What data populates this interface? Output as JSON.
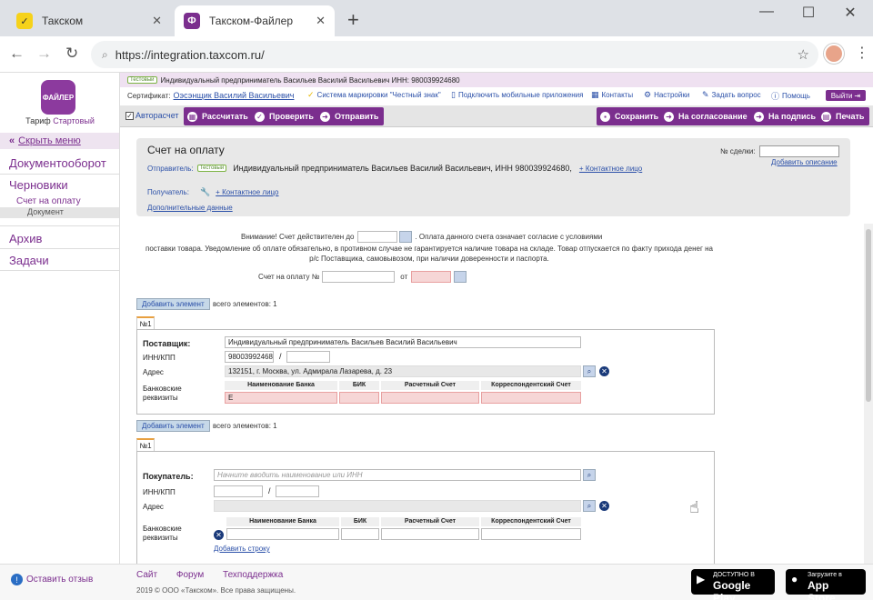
{
  "browser": {
    "tabs": [
      {
        "title": "Такском",
        "favicon": "yellow-t-logo"
      },
      {
        "title": "Такском-Файлер",
        "favicon": "purple-filer-logo"
      }
    ],
    "url": "https://integration.taxcom.ru/"
  },
  "sidebar": {
    "logo_text": "ФАЙЛЕР",
    "tariff_label": "Тариф",
    "tariff_plan": "Стартовый",
    "hide_menu": "Скрыть меню",
    "items": [
      {
        "label": "Документооборот"
      },
      {
        "label": "Черновики"
      },
      {
        "label": "Архив"
      },
      {
        "label": "Задачи"
      }
    ],
    "sub_item": "Счет на оплату",
    "sub_sub_item": "Документ"
  },
  "topbar": {
    "test_badge": "Тестовый",
    "org": "Индивидуальный предприниматель Васильев Василий Васильевич ИНН: 980039924680",
    "cert_label": "Сертификат:",
    "cert_name": "Оэсэнщик Василий Васильевич",
    "links": [
      {
        "label": "Система маркировки \"Честный знак\""
      },
      {
        "label": "Подключить мобильные приложения"
      },
      {
        "label": "Контакты"
      },
      {
        "label": "Настройки"
      },
      {
        "label": "Задать вопрос"
      },
      {
        "label": "Помощь"
      }
    ],
    "exit": "Выйти"
  },
  "toolbar": {
    "autocalc": "Авторасчет",
    "buttons_left": [
      {
        "label": "Рассчитать"
      },
      {
        "label": "Проверить"
      },
      {
        "label": "Отправить"
      }
    ],
    "buttons_right": [
      {
        "label": "Сохранить"
      },
      {
        "label": "На согласование"
      },
      {
        "label": "На подпись"
      },
      {
        "label": "Печать"
      }
    ]
  },
  "doc": {
    "title": "Счет на оплату",
    "sender_label": "Отправитель:",
    "sender_badge": "Тестовый",
    "sender_value": "Индивидуальный предприниматель Васильев Василий Васильевич, ИНН 980039924680,",
    "contact_link": "+ Контактное лицо",
    "receiver_label": "Получатель:",
    "receiver_contact": "+ Контактное лицо",
    "extra_data": "Дополнительные данные",
    "deal_label": "№ сделки:",
    "add_desc": "Добавить описание"
  },
  "form": {
    "notice_prefix": "Внимание! Счет действителен до",
    "notice_suffix": ". Оплата данного счета означает согласие с условиями",
    "notice_body_line1": "поставки товара. Уведомление об оплате обязательно, в противном случае не гарантируется наличие товара на складе. Товар отпускается по факту прихода денег на",
    "notice_body_line2": "р/с Поставщика, самовывозом, при наличии доверенности и паспорта.",
    "invoice_label": "Счет на оплату №",
    "from_label": "от",
    "add_element": "Добавить элемент",
    "elements_count": "всего элементов: 1",
    "tab_label": "№1",
    "supplier": {
      "label": "Поставщик:",
      "name": "Индивидуальный предприниматель Васильев Василий Васильевич",
      "inn_label": "ИНН/КПП",
      "inn": "980039924680",
      "address_label": "Адрес",
      "address": "132151, г. Москва, ул. Адмирала Лазарева, д. 23",
      "bank_label_1": "Банковские",
      "bank_label_2": "реквизиты",
      "bank_value": "Е"
    },
    "bank_headers": [
      "Наименование Банка",
      "БИК",
      "Расчетный Счет",
      "Корреспондентский Счет"
    ],
    "buyer": {
      "label": "Покупатель:",
      "placeholder": "Начните вводить наименование или ИНН",
      "inn_label": "ИНН/КПП",
      "address_label": "Адрес",
      "bank_label_1": "Банковские",
      "bank_label_2": "реквизиты",
      "add_row": "Добавить строку"
    }
  },
  "footer": {
    "feedback": "Оставить отзыв",
    "links": [
      "Сайт",
      "Форум",
      "Техподдержка"
    ],
    "copyright": "2019 © ООО «Такском». Все права защищены.",
    "google_small": "ДОСТУПНО В",
    "google_big": "Google Play",
    "apple_small": "Загрузите в",
    "apple_big": "App Store"
  }
}
